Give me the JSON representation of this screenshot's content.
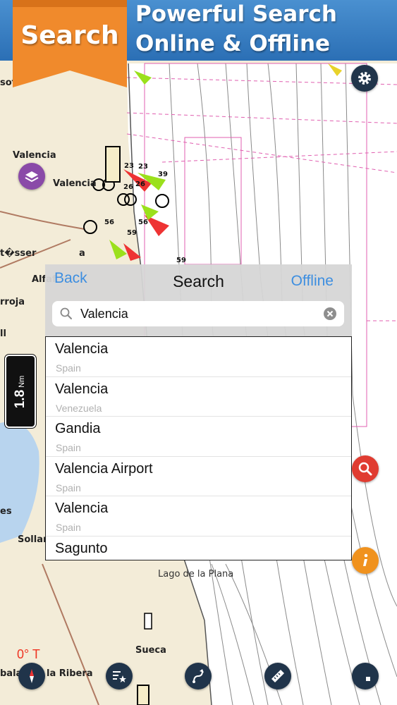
{
  "banner": {
    "ribbon_label": "Search",
    "line1": "Powerful Search",
    "line2": "Online & Offline",
    "ribbon_color": "#f08a2c",
    "banner_color": "#2f78be"
  },
  "map": {
    "place_labels": [
      "sot",
      "Valencia",
      "Valencia",
      "t�sser",
      "a",
      "Alfaf",
      "rroja",
      "ll",
      "es",
      "Sollan",
      "Lago de la Plana",
      "Sueca",
      "bala",
      "la Ribera"
    ],
    "depth_numbers": [
      "23",
      "23",
      "39",
      "26",
      "26",
      "56",
      "56",
      "59",
      "59"
    ],
    "heading_readout": "0° T"
  },
  "scale": {
    "value": "1.8",
    "unit": "Nm"
  },
  "search": {
    "back_label": "Back",
    "title": "Search",
    "offline_label": "Offline",
    "query": "Valencia",
    "results": [
      {
        "name": "Valencia",
        "country": "Spain"
      },
      {
        "name": "Valencia",
        "country": "Venezuela"
      },
      {
        "name": "Gandia",
        "country": "Spain"
      },
      {
        "name": "Valencia Airport",
        "country": "Spain"
      },
      {
        "name": "Valencia",
        "country": "Spain"
      },
      {
        "name": "Sagunto",
        "country": ""
      }
    ]
  },
  "icons": {
    "settings": "gear-icon",
    "layers": "layers-icon",
    "zoom_search": "magnifier-icon",
    "info": "info-icon",
    "compass": "compass-icon",
    "favorites": "star-list-icon",
    "route": "route-icon",
    "ruler": "ruler-icon",
    "stop": "stop-icon"
  }
}
